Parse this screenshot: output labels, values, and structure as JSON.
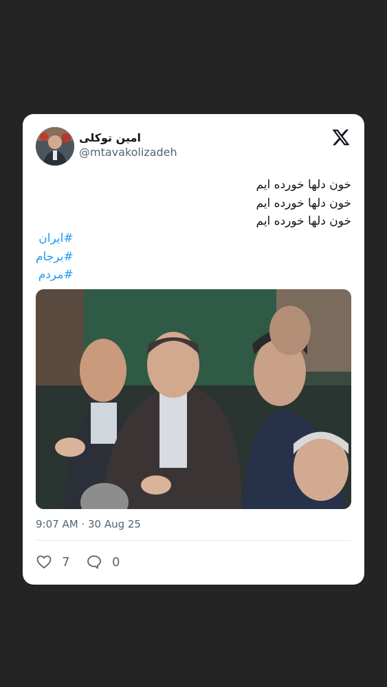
{
  "author": {
    "display_name": "امین توکلی",
    "handle": "@mtavakolizadeh",
    "avatar_icon": "avatar-photo"
  },
  "platform_icon": "x-logo-icon",
  "tweet": {
    "lines": [
      "خون دلها خورده ایم",
      "خون دلها خورده ایم",
      "خون دلها خورده ایم"
    ],
    "hashtags": [
      "#ایران",
      "#برجام",
      "#مردم"
    ],
    "timestamp": "9:07 AM · 30 Aug 25"
  },
  "actions": {
    "likes": "7",
    "replies": "0",
    "like_icon": "heart-icon",
    "reply_icon": "speech-bubble-icon"
  },
  "colors": {
    "background": "#242424",
    "card": "#ffffff",
    "hashtag": "#1d9bf0",
    "secondary_text": "#536471"
  }
}
